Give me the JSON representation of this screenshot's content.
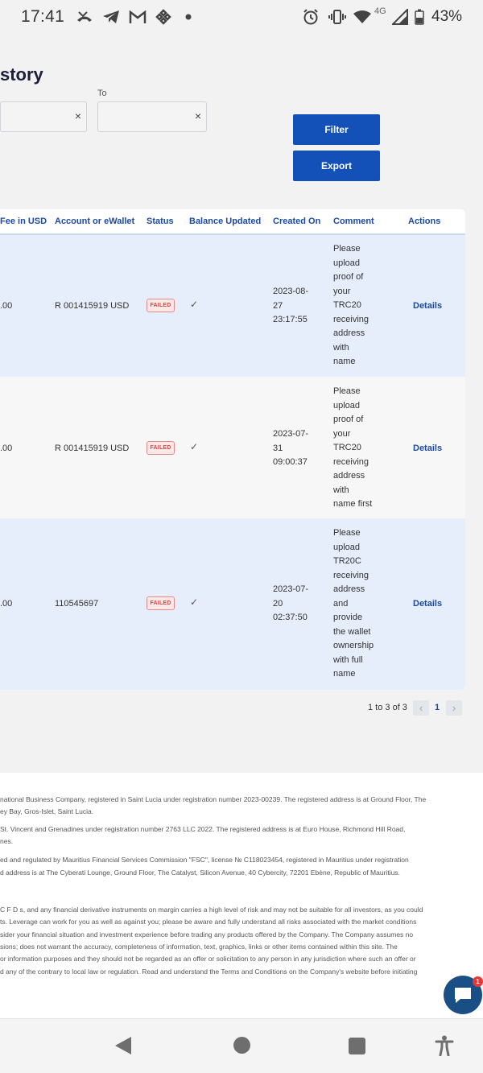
{
  "status_bar": {
    "time": "17:41",
    "network": "4G",
    "battery": "43%",
    "icons": [
      "missed-call-icon",
      "telegram-icon",
      "gmail-icon",
      "binance-icon",
      "dot-icon",
      "alarm-icon",
      "vibrate-icon",
      "wifi-icon",
      "signal-icon",
      "battery-icon"
    ]
  },
  "page": {
    "title": "story",
    "to_label": "To",
    "clear_symbol": "×",
    "filter_label": "Filter",
    "export_label": "Export"
  },
  "table": {
    "headers": [
      "Fee in USD",
      "Account or eWallet",
      "Status",
      "Balance Updated",
      "Created On",
      "Comment",
      "Actions"
    ],
    "rows": [
      {
        "fee": ".00",
        "account": "R 001415919 USD",
        "status": "FAILED",
        "balance_updated": "✓",
        "created": "2023-08-\n27\n23:17:55",
        "comment": "Please\nupload\nproof of\nyour\nTRC20\nreceiving\naddress\nwith\nname",
        "action": "Details"
      },
      {
        "fee": ".00",
        "account": "R 001415919 USD",
        "status": "FAILED",
        "balance_updated": "✓",
        "created": "2023-07-\n31\n09:00:37",
        "comment": "Please\nupload\nproof of\nyour\nTRC20\nreceiving\naddress\nwith\nname first",
        "action": "Details"
      },
      {
        "fee": ".00",
        "account": "110545697",
        "status": "FAILED",
        "balance_updated": "✓",
        "created": "2023-07-\n20\n02:37:50",
        "comment": "Please\nupload\nTR20C\nreceiving\naddress\nand\nprovide\nthe wallet\nownership\nwith full\nname",
        "action": "Details"
      }
    ]
  },
  "pagination": {
    "summary": "1 to 3 of 3",
    "current_page": "1",
    "prev_symbol": "‹",
    "next_symbol": "›"
  },
  "footer": {
    "lines": [
      "national Business Company, registered in Saint Lucia under registration number 2023-00239. The registered address is at Ground Floor, The",
      "ey Bay, Gros-Islet, Saint Lucia.",
      "St. Vincent and Grenadines under registration number 2763 LLC 2022. The registered address is at Euro House, Richmond Hill Road,",
      "nes.",
      "ed and regulated by Mauritius Financial Services Commission \"FSC\", license № C118023454, registered in Mauritius under registration",
      "d address is at The Cyberati Lounge, Ground Floor, The Catalyst, Silicon Avenue, 40 Cybercity, 72201 Ebène, Republic of Mauritius.",
      "C F D s, and any financial derivative instruments on margin carries a high level of risk and may not be suitable for all investors, as you could",
      "ts. Leverage can work for you as well as against you; please be aware and fully understand all risks associated with the market conditions",
      "sider your financial situation and investment experience before trading any products offered by the Company. The Company assumes no",
      "sions; does not warrant the accuracy, completeness of information, text, graphics, links or other items contained within this site. The",
      "or information purposes and they should not be regarded as an offer or solicitation to any person in any jurisdiction where such an offer or",
      "d any of the contrary to local law or regulation. Read and understand the Terms and Conditions on the Company's website before initiating"
    ]
  },
  "chat": {
    "badge_count": "1"
  }
}
